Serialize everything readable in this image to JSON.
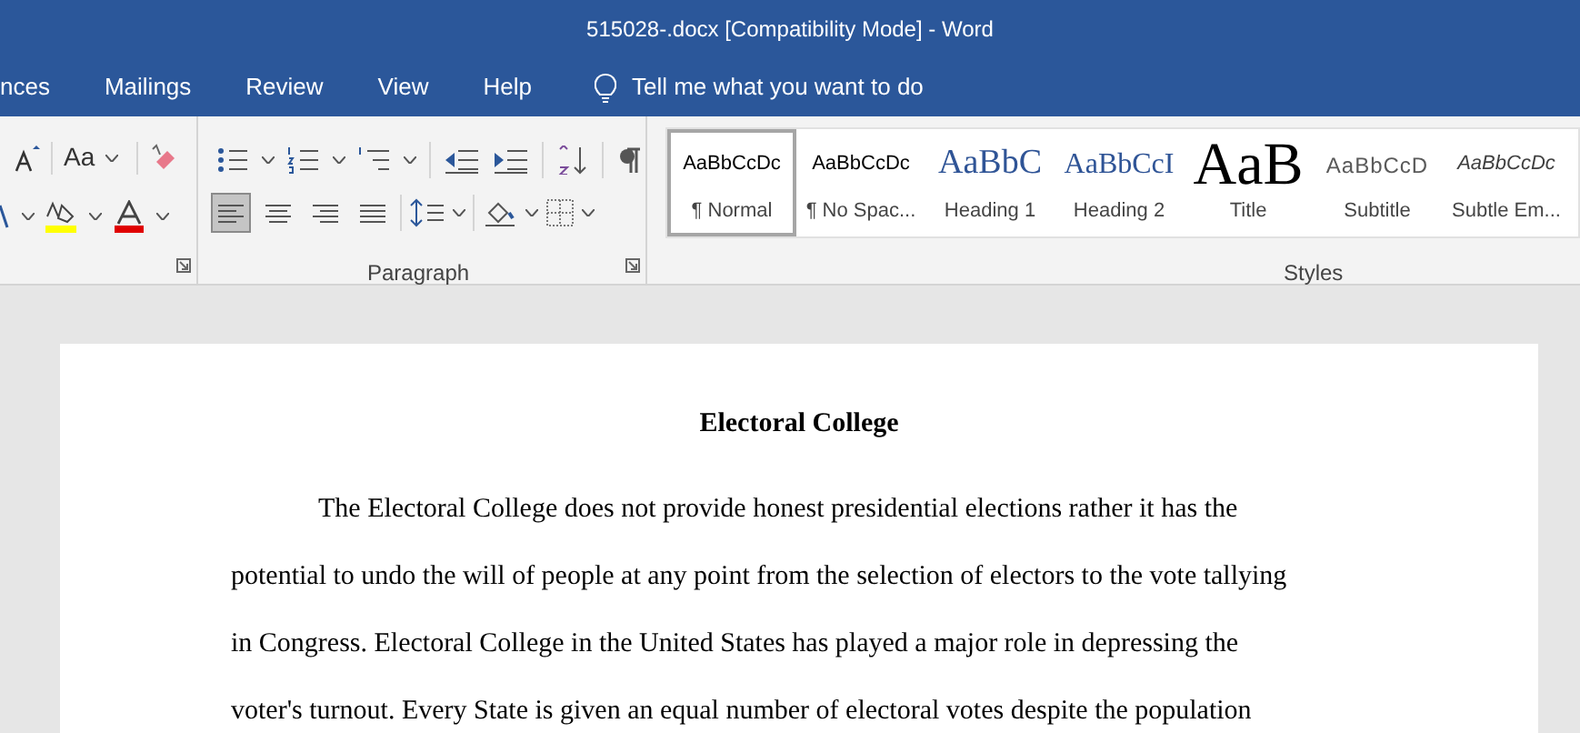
{
  "window": {
    "title": "515028-.docx [Compatibility Mode] - Word"
  },
  "tabs": [
    {
      "label": "nces",
      "selected": false
    },
    {
      "label": "Mailings",
      "selected": false
    },
    {
      "label": "Review",
      "selected": false
    },
    {
      "label": "View",
      "selected": false
    },
    {
      "label": "Help",
      "selected": false
    }
  ],
  "tell_me": {
    "placeholder": "Tell me what you want to do"
  },
  "font_group": {
    "change_case": "Aa"
  },
  "paragraph_group": {
    "label": "Paragraph",
    "alignment": [
      {
        "selected": true
      },
      {
        "selected": false
      },
      {
        "selected": false
      },
      {
        "selected": false
      }
    ]
  },
  "styles_group": {
    "label": "Styles",
    "styles": [
      {
        "preview": "AaBbCcDc",
        "name": "¶ Normal",
        "kind": "normal",
        "selected": true
      },
      {
        "preview": "AaBbCcDc",
        "name": "¶ No Spac...",
        "kind": "normal",
        "selected": false
      },
      {
        "preview": "AaBbC",
        "name": "Heading 1",
        "kind": "heading1",
        "selected": false
      },
      {
        "preview": "AaBbCcI",
        "name": "Heading 2",
        "kind": "heading2",
        "selected": false
      },
      {
        "preview": "AaB",
        "name": "Title",
        "kind": "title",
        "selected": false
      },
      {
        "preview": "AaBbCcD",
        "name": "Subtitle",
        "kind": "subtitle",
        "selected": false
      },
      {
        "preview": "AaBbCcDc",
        "name": "Subtle Em...",
        "kind": "emphasis",
        "selected": false
      }
    ]
  },
  "document": {
    "heading": "Electoral College",
    "lines": [
      "The Electoral College does not provide honest presidential elections rather it has the",
      "potential to undo the will of people at any point from the selection of electors to the vote tallying",
      "in Congress. Electoral College in the United States has played a major role in depressing the",
      "voter's turnout. Every State is given an equal number of electoral votes despite the population"
    ]
  }
}
